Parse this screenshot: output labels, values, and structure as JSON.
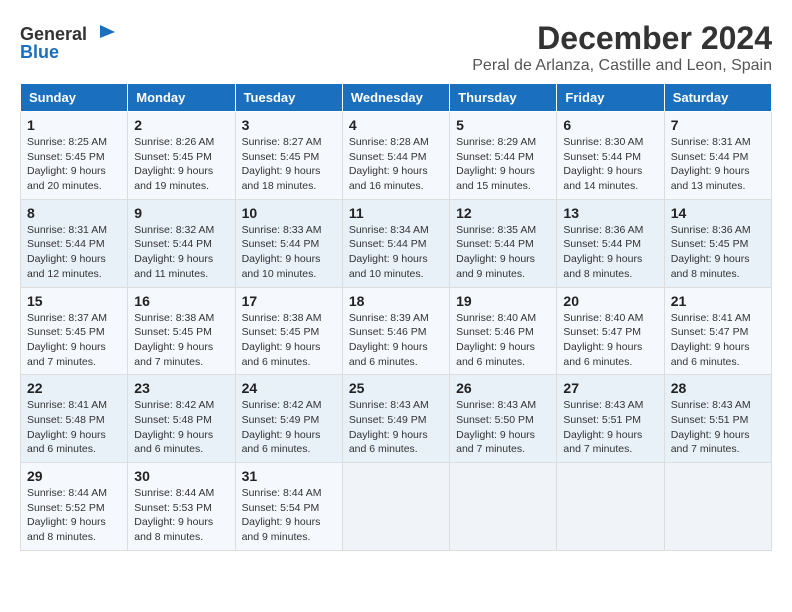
{
  "header": {
    "logo_general": "General",
    "logo_blue": "Blue",
    "month_year": "December 2024",
    "location": "Peral de Arlanza, Castille and Leon, Spain"
  },
  "days_of_week": [
    "Sunday",
    "Monday",
    "Tuesday",
    "Wednesday",
    "Thursday",
    "Friday",
    "Saturday"
  ],
  "weeks": [
    [
      {
        "day": "1",
        "sunrise": "8:25 AM",
        "sunset": "5:45 PM",
        "daylight": "9 hours and 20 minutes."
      },
      {
        "day": "2",
        "sunrise": "8:26 AM",
        "sunset": "5:45 PM",
        "daylight": "9 hours and 19 minutes."
      },
      {
        "day": "3",
        "sunrise": "8:27 AM",
        "sunset": "5:45 PM",
        "daylight": "9 hours and 18 minutes."
      },
      {
        "day": "4",
        "sunrise": "8:28 AM",
        "sunset": "5:44 PM",
        "daylight": "9 hours and 16 minutes."
      },
      {
        "day": "5",
        "sunrise": "8:29 AM",
        "sunset": "5:44 PM",
        "daylight": "9 hours and 15 minutes."
      },
      {
        "day": "6",
        "sunrise": "8:30 AM",
        "sunset": "5:44 PM",
        "daylight": "9 hours and 14 minutes."
      },
      {
        "day": "7",
        "sunrise": "8:31 AM",
        "sunset": "5:44 PM",
        "daylight": "9 hours and 13 minutes."
      }
    ],
    [
      {
        "day": "8",
        "sunrise": "8:31 AM",
        "sunset": "5:44 PM",
        "daylight": "9 hours and 12 minutes."
      },
      {
        "day": "9",
        "sunrise": "8:32 AM",
        "sunset": "5:44 PM",
        "daylight": "9 hours and 11 minutes."
      },
      {
        "day": "10",
        "sunrise": "8:33 AM",
        "sunset": "5:44 PM",
        "daylight": "9 hours and 10 minutes."
      },
      {
        "day": "11",
        "sunrise": "8:34 AM",
        "sunset": "5:44 PM",
        "daylight": "9 hours and 10 minutes."
      },
      {
        "day": "12",
        "sunrise": "8:35 AM",
        "sunset": "5:44 PM",
        "daylight": "9 hours and 9 minutes."
      },
      {
        "day": "13",
        "sunrise": "8:36 AM",
        "sunset": "5:44 PM",
        "daylight": "9 hours and 8 minutes."
      },
      {
        "day": "14",
        "sunrise": "8:36 AM",
        "sunset": "5:45 PM",
        "daylight": "9 hours and 8 minutes."
      }
    ],
    [
      {
        "day": "15",
        "sunrise": "8:37 AM",
        "sunset": "5:45 PM",
        "daylight": "9 hours and 7 minutes."
      },
      {
        "day": "16",
        "sunrise": "8:38 AM",
        "sunset": "5:45 PM",
        "daylight": "9 hours and 7 minutes."
      },
      {
        "day": "17",
        "sunrise": "8:38 AM",
        "sunset": "5:45 PM",
        "daylight": "9 hours and 6 minutes."
      },
      {
        "day": "18",
        "sunrise": "8:39 AM",
        "sunset": "5:46 PM",
        "daylight": "9 hours and 6 minutes."
      },
      {
        "day": "19",
        "sunrise": "8:40 AM",
        "sunset": "5:46 PM",
        "daylight": "9 hours and 6 minutes."
      },
      {
        "day": "20",
        "sunrise": "8:40 AM",
        "sunset": "5:47 PM",
        "daylight": "9 hours and 6 minutes."
      },
      {
        "day": "21",
        "sunrise": "8:41 AM",
        "sunset": "5:47 PM",
        "daylight": "9 hours and 6 minutes."
      }
    ],
    [
      {
        "day": "22",
        "sunrise": "8:41 AM",
        "sunset": "5:48 PM",
        "daylight": "9 hours and 6 minutes."
      },
      {
        "day": "23",
        "sunrise": "8:42 AM",
        "sunset": "5:48 PM",
        "daylight": "9 hours and 6 minutes."
      },
      {
        "day": "24",
        "sunrise": "8:42 AM",
        "sunset": "5:49 PM",
        "daylight": "9 hours and 6 minutes."
      },
      {
        "day": "25",
        "sunrise": "8:43 AM",
        "sunset": "5:49 PM",
        "daylight": "9 hours and 6 minutes."
      },
      {
        "day": "26",
        "sunrise": "8:43 AM",
        "sunset": "5:50 PM",
        "daylight": "9 hours and 7 minutes."
      },
      {
        "day": "27",
        "sunrise": "8:43 AM",
        "sunset": "5:51 PM",
        "daylight": "9 hours and 7 minutes."
      },
      {
        "day": "28",
        "sunrise": "8:43 AM",
        "sunset": "5:51 PM",
        "daylight": "9 hours and 7 minutes."
      }
    ],
    [
      {
        "day": "29",
        "sunrise": "8:44 AM",
        "sunset": "5:52 PM",
        "daylight": "9 hours and 8 minutes."
      },
      {
        "day": "30",
        "sunrise": "8:44 AM",
        "sunset": "5:53 PM",
        "daylight": "9 hours and 8 minutes."
      },
      {
        "day": "31",
        "sunrise": "8:44 AM",
        "sunset": "5:54 PM",
        "daylight": "9 hours and 9 minutes."
      },
      null,
      null,
      null,
      null
    ]
  ],
  "labels": {
    "sunrise": "Sunrise:",
    "sunset": "Sunset:",
    "daylight": "Daylight:"
  }
}
